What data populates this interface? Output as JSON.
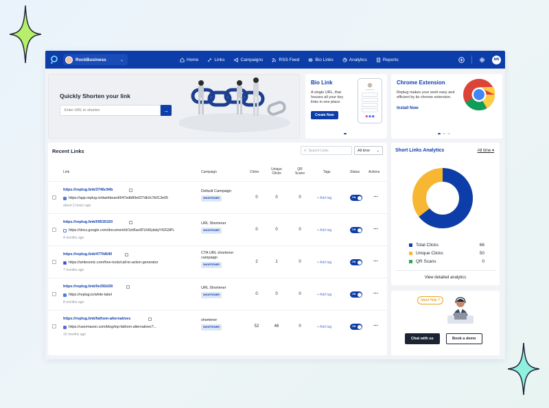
{
  "workspace": {
    "name": "RockBusiness"
  },
  "nav": {
    "items": [
      "Home",
      "Links",
      "Campaigns",
      "RSS Feed",
      "Bio Links",
      "Analytics",
      "Reports"
    ],
    "user_initials": "MN"
  },
  "shorten": {
    "title": "Quickly Shorten your link",
    "placeholder": "Enter URL to shorten"
  },
  "bio_link": {
    "title": "Bio Link",
    "text": "A single URL, that houses all your key links in one place.",
    "button": "Create Now"
  },
  "chrome_ext": {
    "title": "Chrome Extension",
    "text": "Replug makes your work easy and efficient by its chrome extension.",
    "link": "Install Now"
  },
  "recent": {
    "title": "Recent Links",
    "search_placeholder": "Search Links",
    "filter": "All time",
    "columns": {
      "link": "Link",
      "campaign": "Campaign",
      "clicks": "Clicks",
      "unique": "Unique Clicks",
      "qr": "QR Scans",
      "tags": "Tags",
      "status": "Status",
      "actions": "Actions"
    },
    "add_tag": "+ Add tag",
    "toggle_label": "ON",
    "rows": [
      {
        "short": "https://replug.link/3746c94b",
        "dest": "https://app.replug.io/dashboard/647edb89e027db3c7b013e05",
        "ago": "about 2 hours ago",
        "campaign": "Default Campaign",
        "badge": "SHORTENER",
        "clicks": "0",
        "unique": "0",
        "qr": "0"
      },
      {
        "short": "https://replug.link/09535320",
        "dest": "https://docs.google.com/document/d/1zti5ac0FUH0ykdqY42G9PL",
        "ago": "4 months ago",
        "campaign": "URL Shortener",
        "badge": "SHORTENER",
        "clicks": "0",
        "unique": "0",
        "qr": "0"
      },
      {
        "short": "https://replug.link/477fd640",
        "dest": "https://writesonic.com/free-tools/call-to-action-generator",
        "ago": "7 months ago",
        "campaign": "CTA URL shortener campaign",
        "badge": "SHORTENER",
        "clicks": "2",
        "unique": "1",
        "qr": "0"
      },
      {
        "short": "https://replug.link/0e392d30",
        "dest": "https://replug.io/white-label",
        "ago": "8 months ago",
        "campaign": "URL Shortener",
        "badge": "SHORTENER",
        "clicks": "0",
        "unique": "0",
        "qr": "0"
      },
      {
        "short": "https://replug.link/fathom-alternatives",
        "dest": "https://usermaven.com/blog/top-fathom-alternatives?...",
        "ago": "10 months ago",
        "campaign": "shortener",
        "badge": "SHORTENER",
        "clicks": "52",
        "unique": "46",
        "qr": "0"
      }
    ]
  },
  "analytics": {
    "title": "Short Links Analytics",
    "filter": "All time",
    "more": "View detailed analytics",
    "legend": [
      {
        "label": "Total Clicks",
        "value": "66",
        "color": "#0c3da8"
      },
      {
        "label": "Unique Clicks",
        "value": "50",
        "color": "#f7b733"
      },
      {
        "label": "QR Scans",
        "value": "0",
        "color": "#2fa84f"
      }
    ]
  },
  "help": {
    "bubble": "Need Help ?",
    "chat": "Chat with us",
    "demo": "Book a demo"
  }
}
